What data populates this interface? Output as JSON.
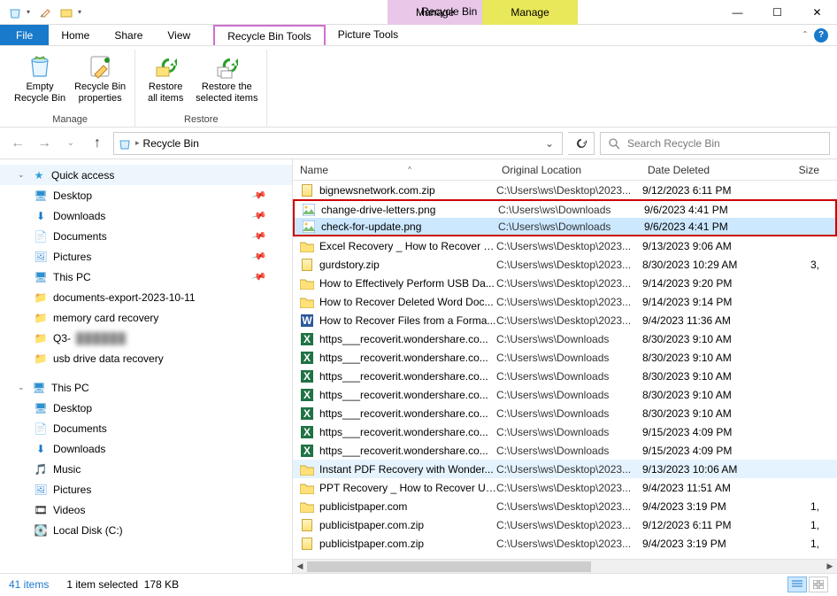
{
  "window": {
    "title": "Recycle Bin",
    "contextual_tabs": [
      {
        "label": "Manage",
        "color": "pink"
      },
      {
        "label": "Manage",
        "color": "yellow"
      }
    ]
  },
  "ribbon": {
    "tabs": {
      "file": "File",
      "home": "Home",
      "share": "Share",
      "view": "View",
      "recycle_tools": "Recycle Bin Tools",
      "picture_tools": "Picture Tools"
    },
    "groups": {
      "manage": {
        "name": "Manage",
        "empty": "Empty\nRecycle Bin",
        "properties": "Recycle Bin\nproperties"
      },
      "restore": {
        "name": "Restore",
        "restore_all": "Restore\nall items",
        "restore_selected": "Restore the\nselected items"
      }
    }
  },
  "address": {
    "location": "Recycle Bin",
    "search_placeholder": "Search Recycle Bin"
  },
  "nav": {
    "quick_access": "Quick access",
    "desktop": "Desktop",
    "downloads": "Downloads",
    "documents": "Documents",
    "pictures": "Pictures",
    "this_pc_pinned": "This PC",
    "docs_export": "documents-export-2023-10-11",
    "memory_card": "memory card recovery",
    "q3": "Q3-",
    "usb_drive": "usb drive data recovery",
    "this_pc": "This PC",
    "tp_desktop": "Desktop",
    "tp_documents": "Documents",
    "tp_downloads": "Downloads",
    "tp_music": "Music",
    "tp_pictures": "Pictures",
    "tp_videos": "Videos",
    "tp_localdisk": "Local Disk (C:)"
  },
  "columns": {
    "name": "Name",
    "location": "Original Location",
    "date": "Date Deleted",
    "size": "Size"
  },
  "files": [
    {
      "icon": "zip",
      "name": "bignewsnetwork.com.zip",
      "loc": "C:\\Users\\ws\\Desktop\\2023...",
      "date": "9/12/2023 6:11 PM",
      "size": "",
      "sel": false,
      "hb": ""
    },
    {
      "icon": "img",
      "name": "change-drive-letters.png",
      "loc": "C:\\Users\\ws\\Downloads",
      "date": "9/6/2023 4:41 PM",
      "size": "",
      "sel": false,
      "hb": "top"
    },
    {
      "icon": "img",
      "name": "check-for-update.png",
      "loc": "C:\\Users\\ws\\Downloads",
      "date": "9/6/2023 4:41 PM",
      "size": "",
      "sel": true,
      "hb": "bottom"
    },
    {
      "icon": "folder",
      "name": "Excel Recovery _ How to Recover U...",
      "loc": "C:\\Users\\ws\\Desktop\\2023...",
      "date": "9/13/2023 9:06 AM",
      "size": "",
      "sel": false,
      "hb": ""
    },
    {
      "icon": "zip",
      "name": "gurdstory.zip",
      "loc": "C:\\Users\\ws\\Desktop\\2023...",
      "date": "8/30/2023 10:29 AM",
      "size": "3,",
      "sel": false,
      "hb": ""
    },
    {
      "icon": "folder",
      "name": "How to Effectively Perform USB Da...",
      "loc": "C:\\Users\\ws\\Desktop\\2023...",
      "date": "9/14/2023 9:20 PM",
      "size": "",
      "sel": false,
      "hb": ""
    },
    {
      "icon": "folder",
      "name": "How to Recover Deleted Word Doc...",
      "loc": "C:\\Users\\ws\\Desktop\\2023...",
      "date": "9/14/2023 9:14 PM",
      "size": "",
      "sel": false,
      "hb": ""
    },
    {
      "icon": "word",
      "name": "How to Recover Files from a Forma...",
      "loc": "C:\\Users\\ws\\Desktop\\2023...",
      "date": "9/4/2023 11:36 AM",
      "size": "",
      "sel": false,
      "hb": ""
    },
    {
      "icon": "excel",
      "name": "https___recoverit.wondershare.co...",
      "loc": "C:\\Users\\ws\\Downloads",
      "date": "8/30/2023 9:10 AM",
      "size": "",
      "sel": false,
      "hb": ""
    },
    {
      "icon": "excel",
      "name": "https___recoverit.wondershare.co...",
      "loc": "C:\\Users\\ws\\Downloads",
      "date": "8/30/2023 9:10 AM",
      "size": "",
      "sel": false,
      "hb": ""
    },
    {
      "icon": "excel",
      "name": "https___recoverit.wondershare.co...",
      "loc": "C:\\Users\\ws\\Downloads",
      "date": "8/30/2023 9:10 AM",
      "size": "",
      "sel": false,
      "hb": ""
    },
    {
      "icon": "excel",
      "name": "https___recoverit.wondershare.co...",
      "loc": "C:\\Users\\ws\\Downloads",
      "date": "8/30/2023 9:10 AM",
      "size": "",
      "sel": false,
      "hb": ""
    },
    {
      "icon": "excel",
      "name": "https___recoverit.wondershare.co...",
      "loc": "C:\\Users\\ws\\Downloads",
      "date": "8/30/2023 9:10 AM",
      "size": "",
      "sel": false,
      "hb": ""
    },
    {
      "icon": "excel",
      "name": "https___recoverit.wondershare.co...",
      "loc": "C:\\Users\\ws\\Downloads",
      "date": "9/15/2023 4:09 PM",
      "size": "",
      "sel": false,
      "hb": ""
    },
    {
      "icon": "excel",
      "name": "https___recoverit.wondershare.co...",
      "loc": "C:\\Users\\ws\\Downloads",
      "date": "9/15/2023 4:09 PM",
      "size": "",
      "sel": false,
      "hb": ""
    },
    {
      "icon": "folder",
      "name": "Instant PDF Recovery with Wonder...",
      "loc": "C:\\Users\\ws\\Desktop\\2023...",
      "date": "9/13/2023 10:06 AM",
      "size": "",
      "sel": false,
      "hb": "",
      "pdf": true
    },
    {
      "icon": "folder",
      "name": "PPT Recovery _ How to Recover Un...",
      "loc": "C:\\Users\\ws\\Desktop\\2023...",
      "date": "9/4/2023 11:51 AM",
      "size": "",
      "sel": false,
      "hb": ""
    },
    {
      "icon": "folder",
      "name": "publicistpaper.com",
      "loc": "C:\\Users\\ws\\Desktop\\2023...",
      "date": "9/4/2023 3:19 PM",
      "size": "1,",
      "sel": false,
      "hb": ""
    },
    {
      "icon": "zip",
      "name": "publicistpaper.com.zip",
      "loc": "C:\\Users\\ws\\Desktop\\2023...",
      "date": "9/12/2023 6:11 PM",
      "size": "1,",
      "sel": false,
      "hb": ""
    },
    {
      "icon": "zip",
      "name": "publicistpaper.com.zip",
      "loc": "C:\\Users\\ws\\Desktop\\2023...",
      "date": "9/4/2023 3:19 PM",
      "size": "1,",
      "sel": false,
      "hb": ""
    }
  ],
  "status": {
    "count": "41 items",
    "selected": "1 item selected",
    "size": "178 KB"
  }
}
